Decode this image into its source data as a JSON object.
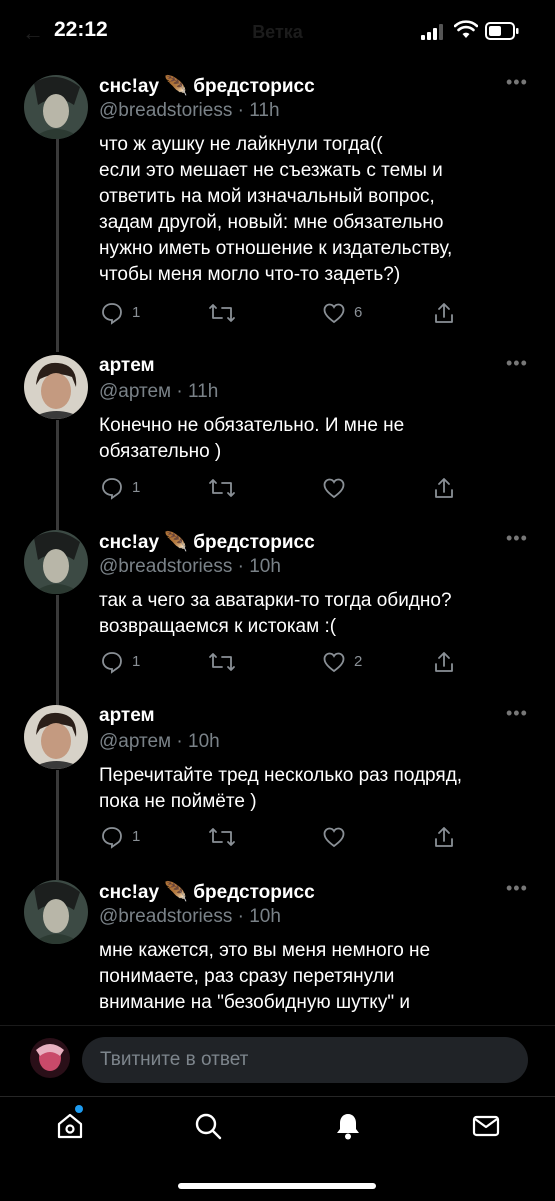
{
  "status_bar": {
    "time": "22:12",
    "title": "Ветка"
  },
  "tweets": [
    {
      "name": "снс!ау 🪶 бредсторисс",
      "handle": "@breadstoriess · 11h",
      "lines": [
        "что ж аушку не лайкнули тогда((",
        "если это мешает не съезжать с темы и",
        "ответить на мой изначальный вопрос,",
        "задам другой, новый: мне обязательно",
        "нужно иметь отношение к издательству,",
        "чтобы меня могло что-то задеть?)"
      ],
      "replies": "1",
      "likes": "6"
    },
    {
      "name": "артем",
      "handle": "@aртем · 11h",
      "lines": [
        "Конечно не обязательно. И мне не",
        "обязательно )"
      ],
      "replies": "1",
      "likes": ""
    },
    {
      "name": "снс!ау 🪶 бредсторисс",
      "handle": "@breadstoriess · 10h",
      "lines": [
        "так а чего за аватарки-то тогда обидно?",
        "возвращаемся к истокам :("
      ],
      "replies": "1",
      "likes": "2"
    },
    {
      "name": "артем",
      "handle": "@aртем · 10h",
      "lines": [
        "Перечитайте тред несколько раз подряд,",
        "пока не поймёте )"
      ],
      "replies": "1",
      "likes": ""
    },
    {
      "name": "снс!ау 🪶 бредсторисс",
      "handle": "@breadstoriess · 10h",
      "lines": [
        "мне кажется, это вы меня немного не",
        "понимаете, раз сразу перетянули",
        "внимание на \"безобидную шутку\" и"
      ],
      "replies": "",
      "likes": ""
    }
  ],
  "composer": {
    "placeholder": "Твитните в ответ"
  },
  "nav": {
    "items": [
      "home-icon",
      "search-icon",
      "notifications-icon",
      "messages-icon"
    ],
    "accent": "#1d9bf0"
  }
}
